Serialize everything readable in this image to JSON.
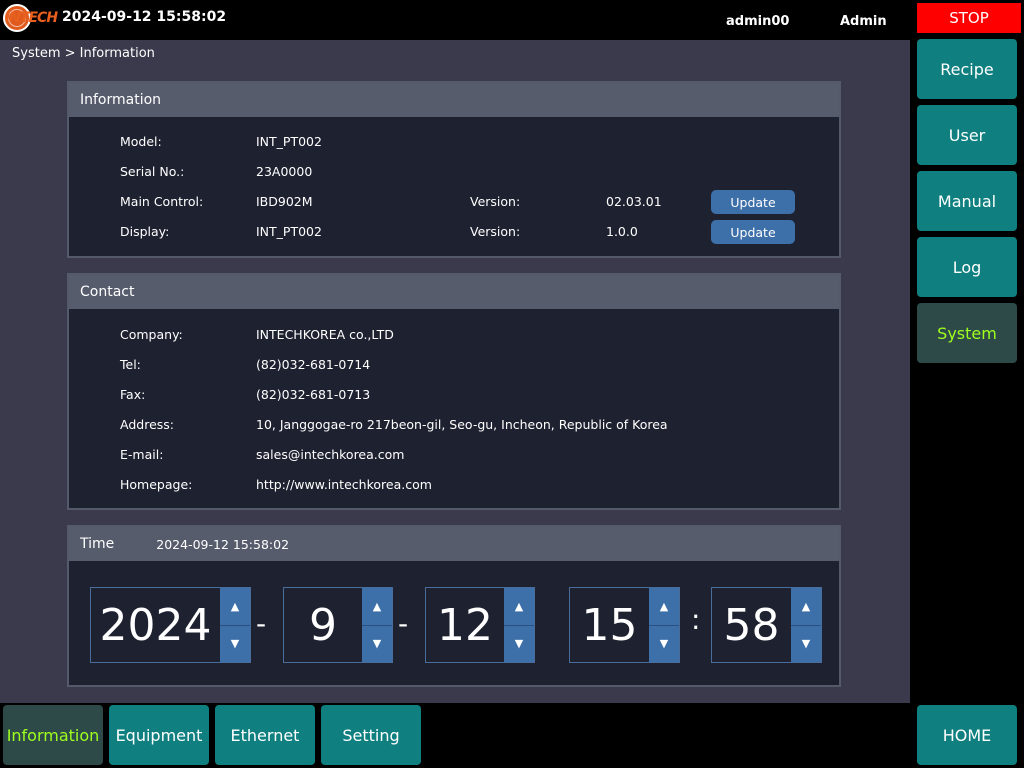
{
  "header": {
    "logo_text": "INTECH",
    "datetime": "2024-09-12 15:58:02",
    "user_id": "admin00",
    "user_role": "Admin"
  },
  "breadcrumb": "System > Information",
  "information": {
    "title": "Information",
    "model_label": "Model:",
    "model_value": "INT_PT002",
    "serial_label": "Serial No.:",
    "serial_value": "23A0000",
    "main_control_label": "Main Control:",
    "main_control_value": "IBD902M",
    "main_version_label": "Version:",
    "main_version_value": "02.03.01",
    "main_update_label": "Update",
    "display_label": "Display:",
    "display_value": "INT_PT002",
    "display_version_label": "Version:",
    "display_version_value": "1.0.0",
    "display_update_label": "Update"
  },
  "contact": {
    "title": "Contact",
    "company_label": "Company:",
    "company_value": "INTECHKOREA co.,LTD",
    "tel_label": "Tel:",
    "tel_value": "(82)032-681-0714",
    "fax_label": "Fax:",
    "fax_value": "(82)032-681-0713",
    "address_label": "Address:",
    "address_value": "10, Janggogae-ro 217beon-gil, Seo-gu, Incheon, Republic of Korea",
    "email_label": "E-mail:",
    "email_value": "sales@intechkorea.com",
    "homepage_label": "Homepage:",
    "homepage_value": "http://www.intechkorea.com"
  },
  "time": {
    "title": "Time",
    "current": "2024-09-12 15:58:02",
    "year": "2024",
    "month": "9",
    "day": "12",
    "hour": "15",
    "minute": "58",
    "date_sep": "-",
    "time_sep": ":",
    "up_glyph": "▲",
    "down_glyph": "▼"
  },
  "sidebar": {
    "stop_label": "STOP",
    "items": [
      {
        "label": "Recipe"
      },
      {
        "label": "User"
      },
      {
        "label": "Manual"
      },
      {
        "label": "Log"
      },
      {
        "label": "System"
      }
    ],
    "home_label": "HOME"
  },
  "tabs": [
    {
      "label": "Information"
    },
    {
      "label": "Equipment"
    },
    {
      "label": "Ethernet"
    },
    {
      "label": "Setting"
    }
  ],
  "colors": {
    "accent_teal": "#0f7f80",
    "active_text": "#9eff1e",
    "stop_red": "#ff0000",
    "button_blue": "#3d6fa9"
  }
}
